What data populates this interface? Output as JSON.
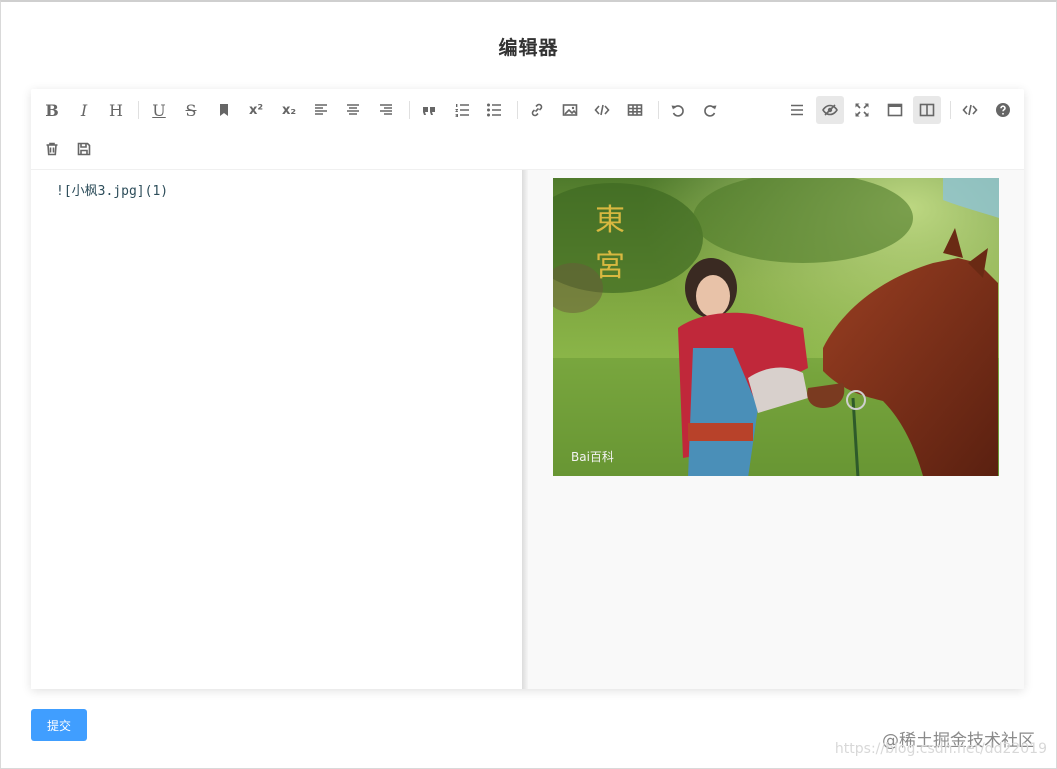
{
  "page": {
    "title": "编辑器"
  },
  "editor": {
    "content": "![小枫3.jpg](1)",
    "toolbar": {
      "bold": "B",
      "italic": "I",
      "header": "H",
      "underline": "U",
      "strikethrough": "S",
      "superscript": "x²",
      "subscript": "x₂"
    },
    "active_tools": [
      "preview",
      "subfield"
    ]
  },
  "preview": {
    "image_watermark_text": "Bai百科",
    "image_seal_text": "東宮"
  },
  "actions": {
    "submit_label": "提交"
  },
  "watermarks": {
    "site": "@稀土掘金技术社区",
    "url": "https://blog.csdn.net/dd22019"
  },
  "colors": {
    "accent": "#409eff",
    "toolbar_icon": "#666666",
    "code_text": "#2d4d5a",
    "active_button_bg": "#e8e8e8"
  }
}
